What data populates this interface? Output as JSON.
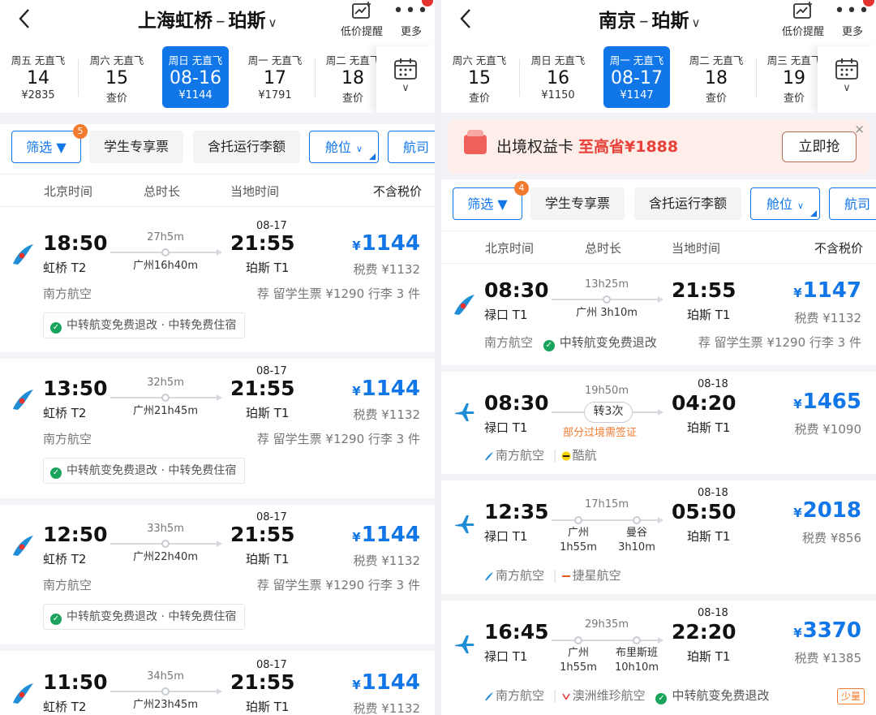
{
  "left": {
    "route": {
      "from": "上海虹桥",
      "dash": "–",
      "to": "珀斯"
    },
    "price_alert_label": "低价提醒",
    "more_label": "更多",
    "dates": [
      {
        "weekday": "周五 无直飞",
        "day": "14",
        "price": "¥2835"
      },
      {
        "weekday": "周六 无直飞",
        "day": "15",
        "price": "查价"
      },
      {
        "weekday": "周日 无直飞",
        "day": "08-16",
        "price": "¥1144"
      },
      {
        "weekday": "周一 无直飞",
        "day": "17",
        "price": "¥1791"
      },
      {
        "weekday": "周二 无直飞",
        "day": "18",
        "price": "查价"
      }
    ],
    "filters": {
      "filter": "筛选",
      "badge": "5",
      "student": "学生专享票",
      "baggage": "含托运行李额",
      "cabin": "舱位",
      "airline": "航司"
    },
    "cols": {
      "bj": "北京时间",
      "dur": "总时长",
      "local": "当地时间",
      "notax": "不含税价"
    },
    "flights": [
      {
        "dep": "18:50",
        "dep_ap": "虹桥 T2",
        "arr": "21:55",
        "arr_ap": "珀斯 T1",
        "arr_date": "08-17",
        "dur": "27h5m",
        "via": "广州16h40m",
        "currency": "¥",
        "price": "1144",
        "tax": "税费 ¥1132",
        "airline": "南方航空",
        "rec": "荐 留学生票 ¥1290 行李 3 件",
        "perk": "中转航变免费退改 · 中转免费住宿"
      },
      {
        "dep": "13:50",
        "dep_ap": "虹桥 T2",
        "arr": "21:55",
        "arr_ap": "珀斯 T1",
        "arr_date": "08-17",
        "dur": "32h5m",
        "via": "广州21h45m",
        "currency": "¥",
        "price": "1144",
        "tax": "税费 ¥1132",
        "airline": "南方航空",
        "rec": "荐 留学生票 ¥1290 行李 3 件",
        "perk": "中转航变免费退改 · 中转免费住宿"
      },
      {
        "dep": "12:50",
        "dep_ap": "虹桥 T2",
        "arr": "21:55",
        "arr_ap": "珀斯 T1",
        "arr_date": "08-17",
        "dur": "33h5m",
        "via": "广州22h40m",
        "currency": "¥",
        "price": "1144",
        "tax": "税费 ¥1132",
        "airline": "南方航空",
        "rec": "荐 留学生票 ¥1290 行李 3 件",
        "perk": "中转航变免费退改 · 中转免费住宿"
      },
      {
        "dep": "11:50",
        "dep_ap": "虹桥 T2",
        "arr": "21:55",
        "arr_ap": "珀斯 T1",
        "arr_date": "08-17",
        "dur": "34h5m",
        "via": "广州23h45m",
        "currency": "¥",
        "price": "1144",
        "tax": "税费 ¥1132"
      }
    ]
  },
  "right": {
    "route": {
      "from": "南京",
      "dash": "–",
      "to": "珀斯"
    },
    "price_alert_label": "低价提醒",
    "more_label": "更多",
    "dates": [
      {
        "weekday": "周六 无直飞",
        "day": "15",
        "price": "查价"
      },
      {
        "weekday": "周日 无直飞",
        "day": "16",
        "price": "¥1150"
      },
      {
        "weekday": "周一 无直飞",
        "day": "08-17",
        "price": "¥1147"
      },
      {
        "weekday": "周二 无直飞",
        "day": "18",
        "price": "查价"
      },
      {
        "weekday": "周三 无直飞",
        "day": "19",
        "price": "查价"
      }
    ],
    "promo": {
      "title": "出境权益卡",
      "highlight": "至高省¥1888",
      "button": "立即抢",
      "close": "×"
    },
    "filters": {
      "filter": "筛选",
      "badge": "4",
      "student": "学生专享票",
      "baggage": "含托运行李额",
      "cabin": "舱位",
      "airline": "航司"
    },
    "cols": {
      "bj": "北京时间",
      "dur": "总时长",
      "local": "当地时间",
      "notax": "不含税价"
    },
    "flights": [
      {
        "dep": "08:30",
        "dep_ap": "禄口 T1",
        "arr": "21:55",
        "arr_ap": "珀斯 T1",
        "dur": "13h25m",
        "via": "广州 3h10m",
        "currency": "¥",
        "price": "1147",
        "tax": "税费 ¥1132",
        "airline": "南方航空",
        "perk": "中转航变免费退改",
        "rec": "荐 留学生票 ¥1290 行李 3 件"
      },
      {
        "dep": "08:30",
        "dep_ap": "禄口 T1",
        "arr": "04:20",
        "arr_ap": "珀斯 T1",
        "arr_date": "08-18",
        "dur": "19h50m",
        "transfer": "转3次",
        "warn": "部分过境需签证",
        "currency": "¥",
        "price": "1465",
        "tax": "税费 ¥1090",
        "airline1": "南方航空",
        "airline2": "酷航"
      },
      {
        "dep": "12:35",
        "dep_ap": "禄口 T1",
        "arr": "05:50",
        "arr_ap": "珀斯 T1",
        "arr_date": "08-18",
        "dur": "17h15m",
        "via1": "广州",
        "via1_t": "1h55m",
        "via2": "曼谷",
        "via2_t": "3h10m",
        "currency": "¥",
        "price": "2018",
        "tax": "税费 ¥856",
        "airline1": "南方航空",
        "airline2": "捷星航空"
      },
      {
        "dep": "16:45",
        "dep_ap": "禄口 T1",
        "arr": "22:20",
        "arr_ap": "珀斯 T1",
        "arr_date": "08-18",
        "dur": "29h35m",
        "via1": "广州",
        "via1_t": "1h55m",
        "via2": "布里斯班",
        "via2_t": "10h10m",
        "currency": "¥",
        "price": "3370",
        "tax": "税费 ¥1385",
        "airline1": "南方航空",
        "airline2": "澳洲维珍航空",
        "perk": "中转航变免费退改",
        "few": "少量"
      }
    ]
  },
  "colors": {
    "accent": "#1176e8",
    "orange": "#f27b30",
    "promo_red": "#e8413a",
    "green": "#1aa35c"
  }
}
